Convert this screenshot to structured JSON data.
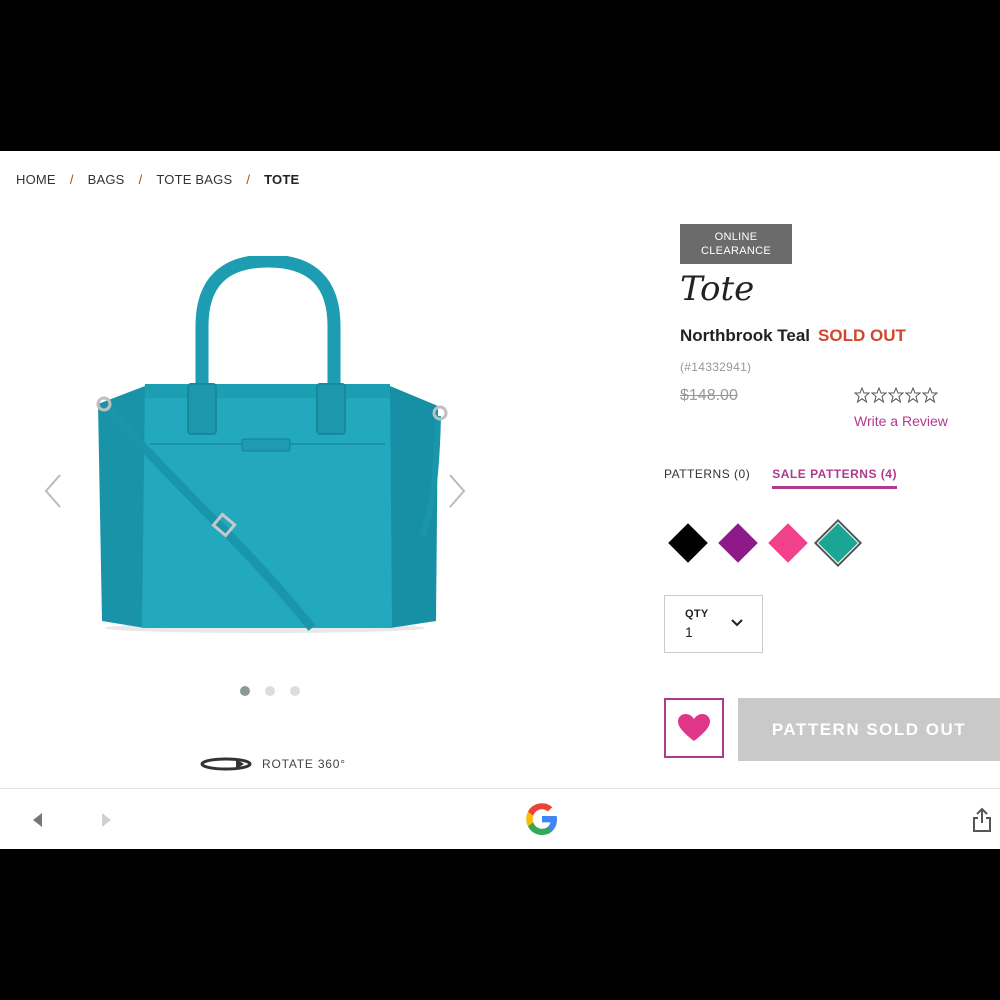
{
  "breadcrumb": {
    "items": [
      "HOME",
      "BAGS",
      "TOTE BAGS"
    ],
    "current": "TOTE",
    "separator": "/"
  },
  "gallery": {
    "image": "teal-tote-bag",
    "dots_count": 3,
    "active_dot": 1,
    "rotate_label": "ROTATE 360°"
  },
  "product": {
    "badge_line1": "ONLINE",
    "badge_line2": "CLEARANCE",
    "title": "Tote",
    "color_name": "Northbrook Teal",
    "availability": "SOLD OUT",
    "sku": "(#14332941)",
    "price": "$148.00",
    "rating": 0,
    "review_link": "Write a Review"
  },
  "tabs": [
    {
      "label": "PATTERNS (0)",
      "active": false
    },
    {
      "label": "SALE PATTERNS (4)",
      "active": true
    }
  ],
  "swatches": [
    {
      "color": "#000000",
      "selected": false
    },
    {
      "color": "#8e1a8a",
      "selected": false
    },
    {
      "color": "#f2408a",
      "selected": false
    },
    {
      "color": "#1aa594",
      "selected": true
    }
  ],
  "qty": {
    "label": "QTY",
    "value": "1"
  },
  "actions": {
    "sold_out_label": "PATTERN SOLD OUT"
  },
  "colors": {
    "accent": "#b03a8e",
    "sold_out": "#d0472b",
    "teal": "#20a4b8"
  }
}
